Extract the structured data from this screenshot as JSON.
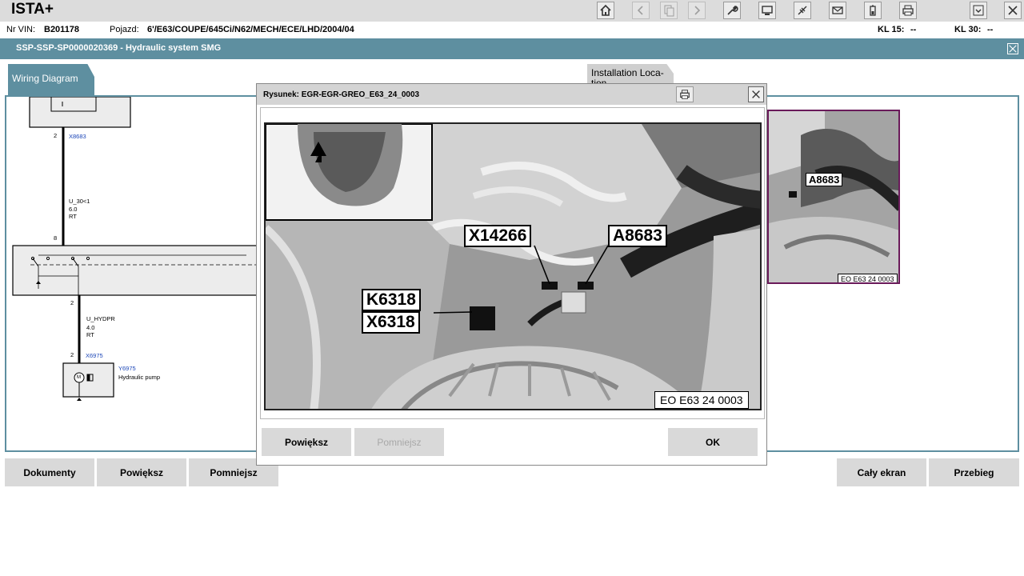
{
  "app": {
    "title": "ISTA+"
  },
  "toolbar": {
    "buttons": [
      {
        "name": "home-icon"
      },
      {
        "name": "back-icon"
      },
      {
        "name": "copy-icon"
      },
      {
        "name": "forward-icon"
      },
      {
        "name": "wrench-icon"
      },
      {
        "name": "display-icon"
      },
      {
        "name": "connection-icon"
      },
      {
        "name": "mail-icon"
      },
      {
        "name": "battery-icon"
      },
      {
        "name": "print-icon"
      },
      {
        "name": "minimize-icon"
      },
      {
        "name": "close-icon"
      }
    ]
  },
  "vehicle": {
    "vin_label": "Nr VIN:",
    "vin": "B201178",
    "vehicle_label": "Pojazd:",
    "vehicle": "6'/E63/COUPE/645Ci/N62/MECH/ECE/LHD/2004/04",
    "kl15_label": "KL 15:",
    "kl15_value": "--",
    "kl30_label": "KL 30:",
    "kl30_value": "--"
  },
  "document": {
    "title": "SSP-SSP-SP0000020369  -  Hydraulic system SMG"
  },
  "tabs": {
    "wiring": "Wiring Diagram",
    "installation": "Installation Loca-tion"
  },
  "wiring": {
    "pin_top": "2",
    "connector_top": "X8683",
    "wire1_name": "U_30<1",
    "wire1_size": "6.0",
    "wire1_color": "RT",
    "pin_relay_in": "8",
    "pin_relay_out": "2",
    "wire2_name": "U_HYDPR",
    "wire2_size": "4.0",
    "wire2_color": "RT",
    "pin_pump": "2",
    "connector_pump": "X6975",
    "pump_id": "Y6975",
    "pump_desc": "Hydraulic pump",
    "motor_symbol": "M"
  },
  "background_image": {
    "callout": "A8683",
    "caption": "EO E63 24 0003"
  },
  "dialog": {
    "title": "Rysunek: EGR-EGR-GREO_E63_24_0003",
    "callouts": {
      "x14266": "X14266",
      "a8683": "A8683",
      "k6318": "K6318",
      "x6318": "X6318"
    },
    "caption": "EO E63 24 0003",
    "zoom_in": "Powiększ",
    "zoom_out": "Pomniejsz",
    "ok": "OK"
  },
  "bottom": {
    "documents": "Dokumenty",
    "zoom_in": "Powiększ",
    "zoom_out": "Pomniejsz",
    "fullscreen": "Cały ekran",
    "procedure": "Przebieg"
  },
  "colors": {
    "accent": "#5e8fa0",
    "link_blue": "#1d47b8",
    "highlight_frame": "#6a1a5a"
  }
}
